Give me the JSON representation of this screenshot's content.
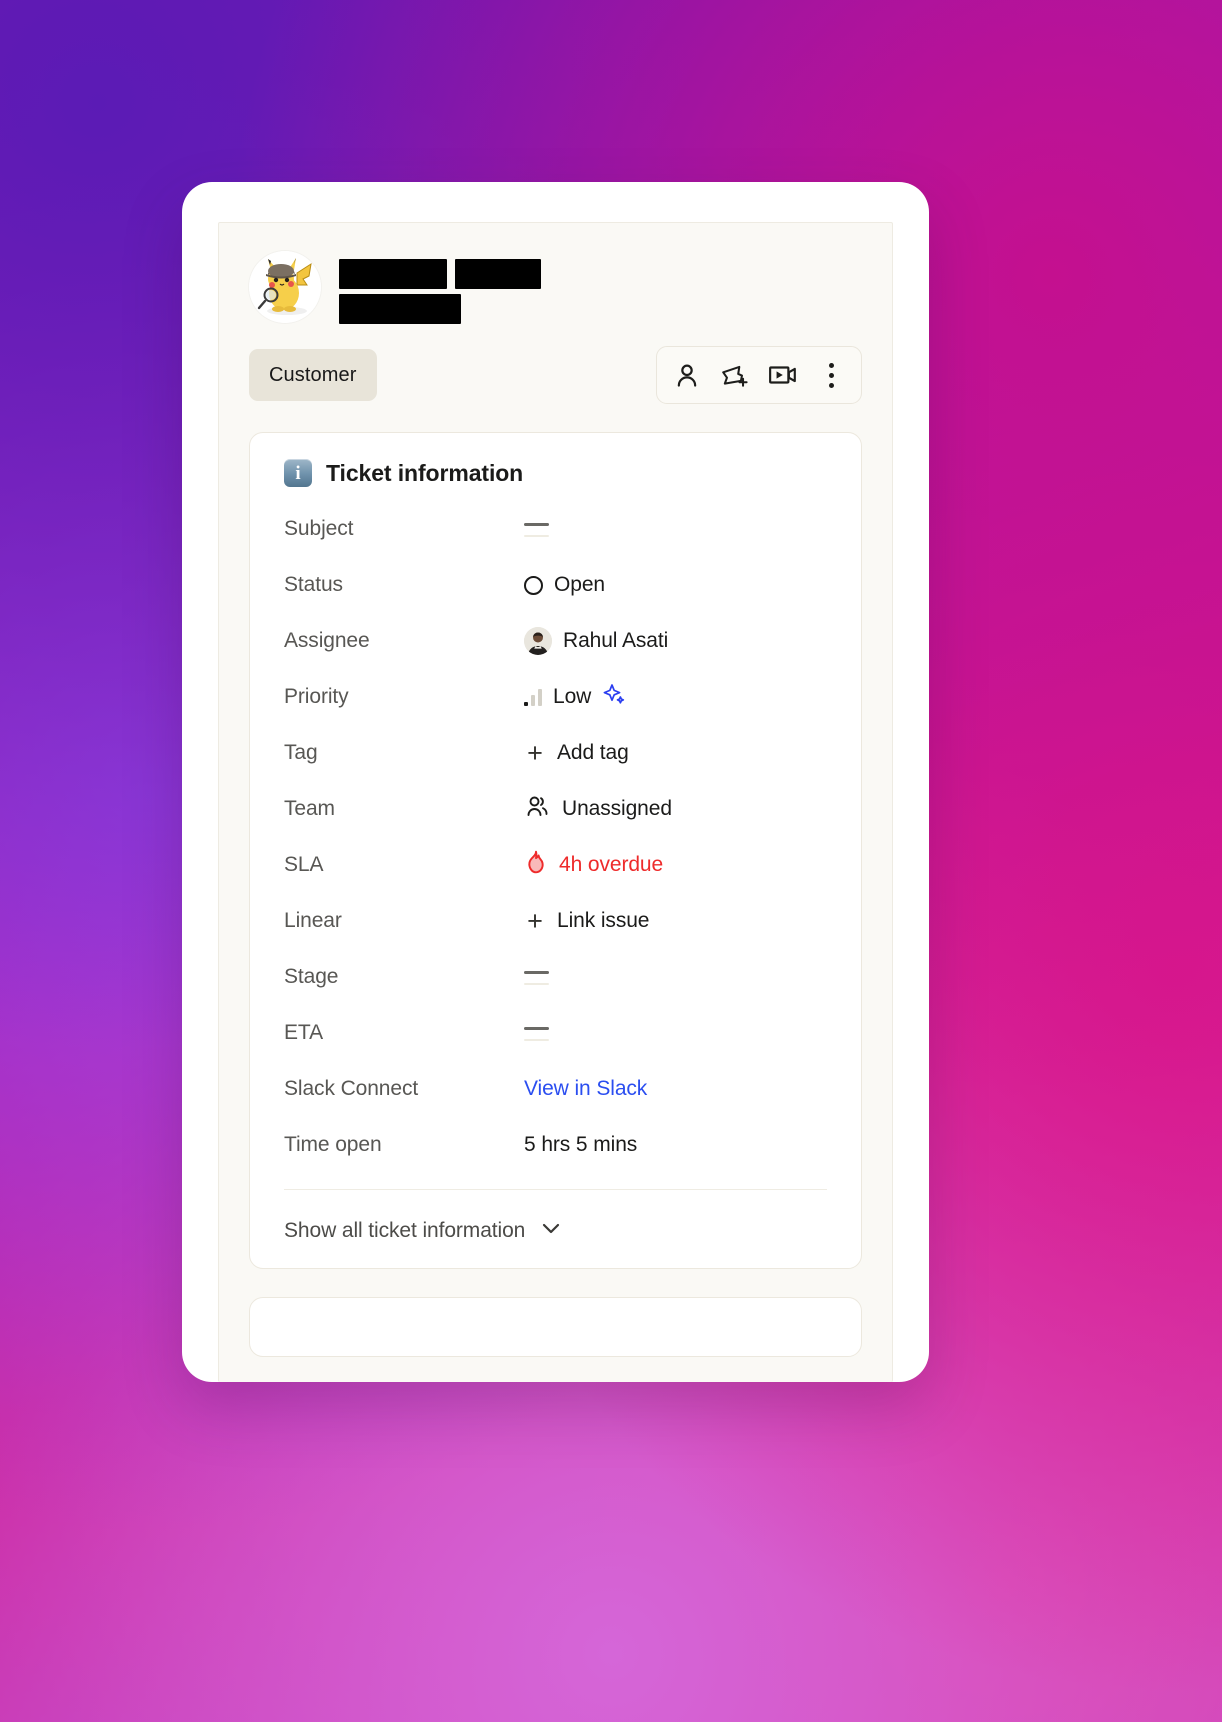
{
  "window": {
    "background_accent": "#c4108f"
  },
  "contact": {
    "avatar_alt": "detective-pikachu-avatar",
    "name_redacted": true,
    "chip_label": "Customer"
  },
  "toolbar": {
    "items": [
      {
        "name": "person-icon",
        "label": "Contact"
      },
      {
        "name": "ticket-plus-icon",
        "label": "Create ticket"
      },
      {
        "name": "video-icon",
        "label": "Video call"
      },
      {
        "name": "kebab-menu-icon",
        "label": "More options"
      }
    ]
  },
  "ticket_card": {
    "icon": "info-icon",
    "title": "Ticket information",
    "rows": [
      {
        "label": "Subject",
        "value": "—",
        "kind": "dash"
      },
      {
        "label": "Status",
        "value": "Open",
        "kind": "status"
      },
      {
        "label": "Assignee",
        "value": "Rahul Asati",
        "kind": "avatar"
      },
      {
        "label": "Priority",
        "value": "Low",
        "kind": "priority"
      },
      {
        "label": "Tag",
        "value": "Add tag",
        "kind": "plus"
      },
      {
        "label": "Team",
        "value": "Unassigned",
        "kind": "team"
      },
      {
        "label": "SLA",
        "value": "4h overdue",
        "kind": "sla"
      },
      {
        "label": "Linear",
        "value": "Link issue",
        "kind": "plus"
      },
      {
        "label": "Stage",
        "value": "—",
        "kind": "dash"
      },
      {
        "label": "ETA",
        "value": "—",
        "kind": "dash"
      },
      {
        "label": "Slack Connect",
        "value": "View in Slack",
        "kind": "link"
      },
      {
        "label": "Time open",
        "value": "5 hrs 5 mins",
        "kind": "text"
      }
    ],
    "footer": {
      "label": "Show all ticket information",
      "chevron": "chevron-down-icon"
    }
  },
  "colors": {
    "sla_red": "#ee2b2b",
    "link_blue": "#2b4ef0",
    "sparkle_blue": "#2b3ef0",
    "chip_bg": "#e8e4d9",
    "panel_bg": "#faf9f5"
  }
}
